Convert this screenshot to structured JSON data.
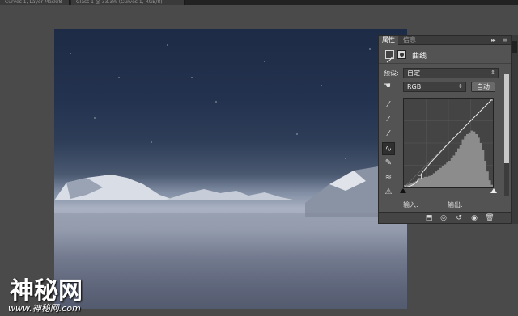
{
  "document_tabs": [
    {
      "label": "Curves 1, Layer Mask/8"
    },
    {
      "label": "Glass 1 @ 33.3% (Curves 1, RGB/8)"
    }
  ],
  "panel": {
    "tabs": [
      {
        "label": "属性",
        "active": true
      },
      {
        "label": "信息",
        "active": false
      }
    ],
    "menu_icon": "≡",
    "collapse_icon": "▸▸",
    "header_title": "曲线",
    "preset_label": "预设:",
    "preset_value": "自定",
    "channel_value": "RGB",
    "auto_button": "自动",
    "input_label": "输入:",
    "output_label": "输出:",
    "accent_color": "#535353"
  },
  "curve": {
    "points": [
      [
        0,
        0
      ],
      [
        45,
        30
      ],
      [
        255,
        255
      ]
    ],
    "histogram": [
      2,
      3,
      4,
      5,
      6,
      7,
      9,
      10,
      11,
      12,
      12,
      13,
      14,
      16,
      18,
      20,
      22,
      24,
      26,
      28,
      30,
      33,
      36,
      40,
      44,
      48,
      54,
      58,
      60,
      62,
      64,
      63,
      60,
      56,
      50,
      42,
      30,
      18,
      8,
      3
    ]
  },
  "watermark": {
    "main": "神秘网",
    "sub": "www.神秘网.com"
  }
}
